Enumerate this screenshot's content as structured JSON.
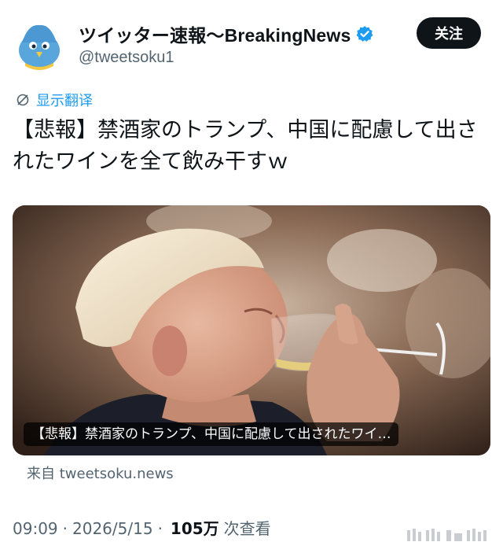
{
  "account": {
    "display_name": "ツイッター速報〜BreakingNews",
    "handle": "@tweetsoku1",
    "verified": true,
    "avatar_icon": "bird-avatar-icon"
  },
  "follow_button": {
    "label": "关注"
  },
  "translate": {
    "label": "显示翻译",
    "icon": "translate-icon"
  },
  "tweet": {
    "text": "【悲報】禁酒家のトランプ、中国に配慮して出されたワインを全て飲み干すｗ"
  },
  "link_card": {
    "caption": "【悲報】禁酒家のトランプ、中国に配慮して出されたワイ…",
    "source": "来自 tweetsoku.news"
  },
  "meta": {
    "time": "09:09",
    "date": "2026/5/15",
    "views": "105万",
    "views_label": "次查看"
  },
  "colors": {
    "accent": "#1d9bf0",
    "text": "#0f1419",
    "secondary": "#536471"
  }
}
